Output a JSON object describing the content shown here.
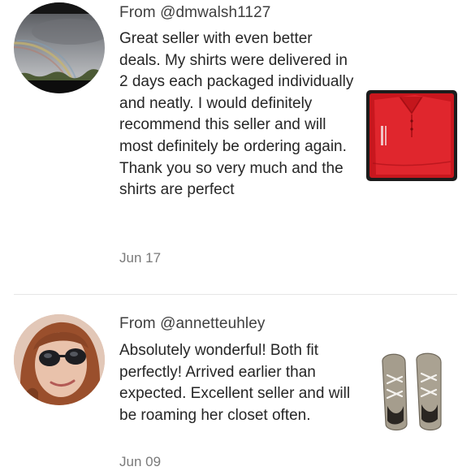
{
  "reviews": [
    {
      "author": "From @dmwalsh1127",
      "text": "Great seller with even better deals. My shirts were delivered in 2 days each packaged individually and neatly. I would definitely recommend this seller and will most definitely be ordering again. Thank you so very much and the shirts are perfect",
      "date": "Jun 17",
      "avatar_icon": "rainbow-landscape-photo",
      "item_icon": "red-polo-shirt-photo"
    },
    {
      "author": "From @annetteuhley",
      "text": "Absolutely wonderful! Both fit perfectly! Arrived earlier than expected. Excellent seller and will be roaming her closet often.",
      "date": "Jun 09",
      "avatar_icon": "woman-sunglasses-photo",
      "item_icon": "gray-sneakers-photo"
    }
  ],
  "colors": {
    "author": "#3f3f3f",
    "text": "#262626",
    "date": "#7a7a7a",
    "divider": "#e6e6e6",
    "shirt_red": "#e8262d"
  }
}
